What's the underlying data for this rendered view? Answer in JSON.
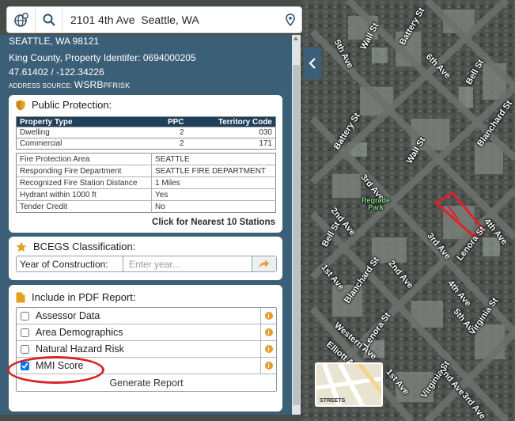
{
  "search": {
    "value": "2101 4th Ave  Seattle, WA",
    "icons": {
      "globe": "globe-icon",
      "search": "search-icon",
      "pin": "map-pin-icon"
    }
  },
  "location": {
    "city_zip": "SEATTLE, WA 98121",
    "county_line": "King County, Property Identifer: 0694000205",
    "coords": "47.61402 / -122.34226",
    "source_label": "ADDRESS SOURCE:",
    "source_value": "WSRB",
    "source_value_small": "PF",
    "source_value_tail": "RISK"
  },
  "public_protection": {
    "title": "Public Protection:",
    "columns": [
      "Property Type",
      "PPC",
      "Territory Code"
    ],
    "rows": [
      [
        "Dwelling",
        "2",
        "030"
      ],
      [
        "Commercial",
        "2",
        "171"
      ]
    ],
    "fire_rows": [
      [
        "Fire Protection Area",
        "SEATTLE"
      ],
      [
        "Responding Fire Department",
        "SEATTLE FIRE DEPARTMENT"
      ],
      [
        "Recognized Fire Station Distance",
        "1 Miles"
      ],
      [
        "Hydrant within 1000 ft",
        "Yes"
      ],
      [
        "Tender Credit",
        "No"
      ]
    ],
    "nearest_link": "Click for Nearest 10 Stations"
  },
  "bcegs": {
    "title": "BCEGS Classification:",
    "yoc_label": "Year of Construction:",
    "yoc_placeholder": "Enter year..."
  },
  "pdf": {
    "title": "Include in PDF Report:",
    "items": [
      {
        "label": "Assessor Data",
        "checked": false
      },
      {
        "label": "Area Demographics",
        "checked": false
      },
      {
        "label": "Natural Hazard Risk",
        "checked": false
      },
      {
        "label": "MMI Score",
        "checked": true
      }
    ],
    "info_glyph": "i",
    "generate": "Generate Report"
  },
  "map": {
    "streets": [
      "Battery St",
      "Wall St",
      "5th Ave",
      "6th Ave",
      "Bell St",
      "Blanchard St",
      "Battery St",
      "Wall St",
      "3rd Ave",
      "4th Ave",
      "2nd Ave",
      "Bell St",
      "Lenora St",
      "3rd Ave",
      "1st Ave",
      "2nd Ave",
      "Blanchard St",
      "4th Ave",
      "5th Ave",
      "Virginia St",
      "Western Ave",
      "Lenora St",
      "Elliott Ave",
      "Virginia St",
      "1st Ave",
      "2nd Ave",
      "3rd Ave"
    ],
    "park": "Regrade\nPark",
    "inset_label": "STREETS",
    "parcel_color": "#e0202a"
  },
  "accent": {
    "panel": "#3c5f78",
    "table_head": "#1f3f5a",
    "info": "#e59c28",
    "highlight": "#d8252a"
  }
}
